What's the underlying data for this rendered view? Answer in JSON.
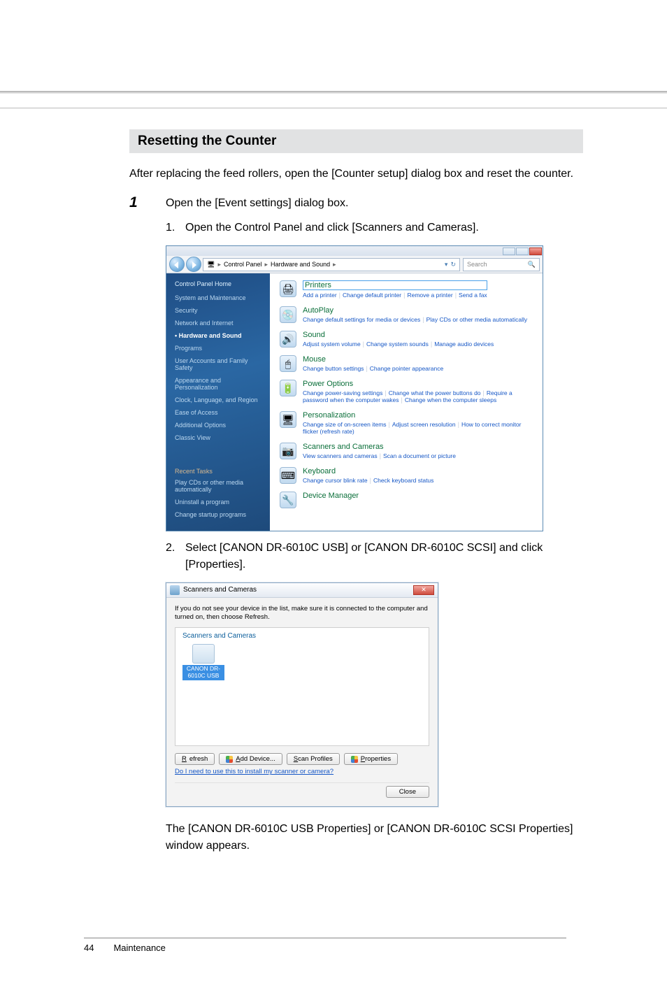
{
  "section_title": "Resetting the Counter",
  "intro": "After replacing the feed rollers, open the [Counter setup] dialog box and reset the counter.",
  "step1": {
    "number": "1",
    "text": "Open the [Event settings] dialog box.",
    "sub1": {
      "num": "1.",
      "text": "Open the Control Panel and click [Scanners and Cameras]."
    },
    "sub2": {
      "num": "2.",
      "text": "Select [CANON DR-6010C USB] or [CANON DR-6010C SCSI] and click [Properties]."
    }
  },
  "control_panel": {
    "crumb1": "Control Panel",
    "crumb2": "Hardware and Sound",
    "search_placeholder": "Search",
    "sidebar": {
      "home": "Control Panel Home",
      "items": [
        "System and Maintenance",
        "Security",
        "Network and Internet",
        "Hardware and Sound",
        "Programs",
        "User Accounts and Family Safety",
        "Appearance and Personalization",
        "Clock, Language, and Region",
        "Ease of Access",
        "Additional Options",
        "Classic View"
      ],
      "recent_label": "Recent Tasks",
      "recent": [
        "Play CDs or other media automatically",
        "Uninstall a program",
        "Change startup programs"
      ]
    },
    "categories": [
      {
        "title": "Printers",
        "tasks": [
          "Add a printer",
          "Change default printer",
          "Remove a printer",
          "Send a fax"
        ],
        "highlighted": true
      },
      {
        "title": "AutoPlay",
        "tasks": [
          "Change default settings for media or devices",
          "Play CDs or other media automatically"
        ]
      },
      {
        "title": "Sound",
        "tasks": [
          "Adjust system volume",
          "Change system sounds",
          "Manage audio devices"
        ]
      },
      {
        "title": "Mouse",
        "tasks": [
          "Change button settings",
          "Change pointer appearance"
        ]
      },
      {
        "title": "Power Options",
        "tasks": [
          "Change power-saving settings",
          "Change what the power buttons do",
          "Require a password when the computer wakes",
          "Change when the computer sleeps"
        ]
      },
      {
        "title": "Personalization",
        "tasks": [
          "Change size of on-screen items",
          "Adjust screen resolution",
          "How to correct monitor flicker (refresh rate)"
        ]
      },
      {
        "title": "Scanners and Cameras",
        "tasks": [
          "View scanners and cameras",
          "Scan a document or picture"
        ]
      },
      {
        "title": "Keyboard",
        "tasks": [
          "Change cursor blink rate",
          "Check keyboard status"
        ]
      },
      {
        "title": "Device Manager",
        "tasks": []
      }
    ]
  },
  "scanners": {
    "title": "Scanners and Cameras",
    "desc": "If you do not see your device in the list, make sure it is connected to the computer and turned on, then choose Refresh.",
    "group_title": "Scanners and Cameras",
    "item_label": "CANON DR-6010C USB",
    "buttons": {
      "refresh": "Refresh",
      "add": "Add Device...",
      "profiles": "Scan Profiles",
      "props": "Properties"
    },
    "link": "Do I need to use this to install my scanner or camera?",
    "close": "Close"
  },
  "result": "The [CANON DR-6010C USB Properties] or [CANON DR-6010C SCSI Properties] window appears.",
  "footer": {
    "page": "44",
    "label": "Maintenance"
  }
}
